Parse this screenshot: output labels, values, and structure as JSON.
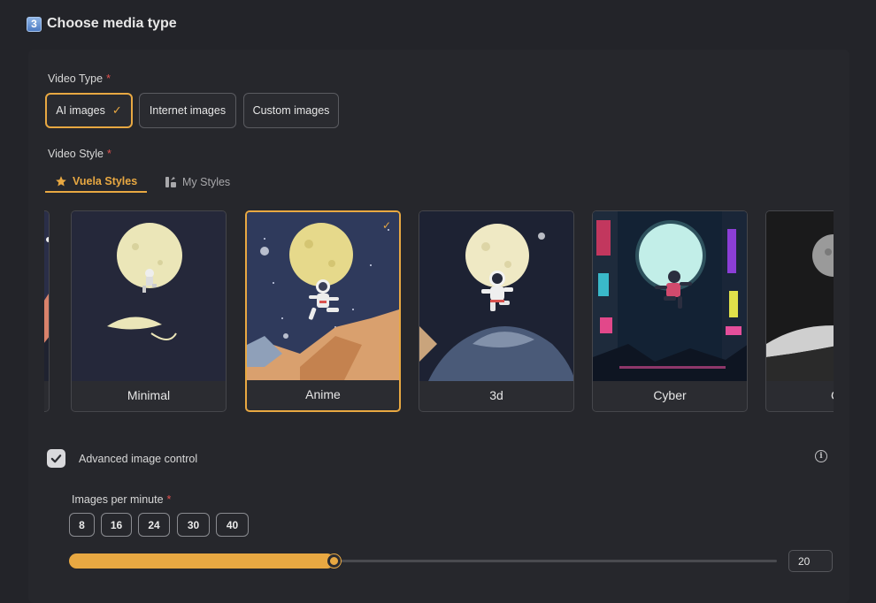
{
  "section": {
    "number": "3",
    "title": "Choose media type"
  },
  "video_type": {
    "label": "Video Type",
    "required_mark": "*",
    "options": [
      {
        "label": "AI images",
        "selected": true
      },
      {
        "label": "Internet images",
        "selected": false
      },
      {
        "label": "Custom images",
        "selected": false
      }
    ],
    "check_glyph": "✓"
  },
  "video_style": {
    "label": "Video Style",
    "required_mark": "*",
    "tabs": [
      {
        "label": "Vuela Styles",
        "icon": "star-icon",
        "active": true
      },
      {
        "label": "My Styles",
        "icon": "my-styles-icon",
        "active": false
      }
    ],
    "cards": [
      {
        "name": "Minimal",
        "selected": false
      },
      {
        "name": "Anime",
        "selected": true
      },
      {
        "name": "3d",
        "selected": false
      },
      {
        "name": "Cyber",
        "selected": false
      },
      {
        "name": "Clas",
        "selected": false
      }
    ]
  },
  "advanced": {
    "label": "Advanced image control",
    "checked": true,
    "info_glyph": "i"
  },
  "images_per_minute": {
    "label": "Images per minute",
    "required_mark": "*",
    "presets": [
      "8",
      "16",
      "24",
      "30",
      "40"
    ],
    "value": "20",
    "slider_fraction": 0.375
  },
  "colors": {
    "accent": "#e8a842",
    "background": "#232429",
    "panel": "#26272c",
    "required": "#e0524f"
  }
}
